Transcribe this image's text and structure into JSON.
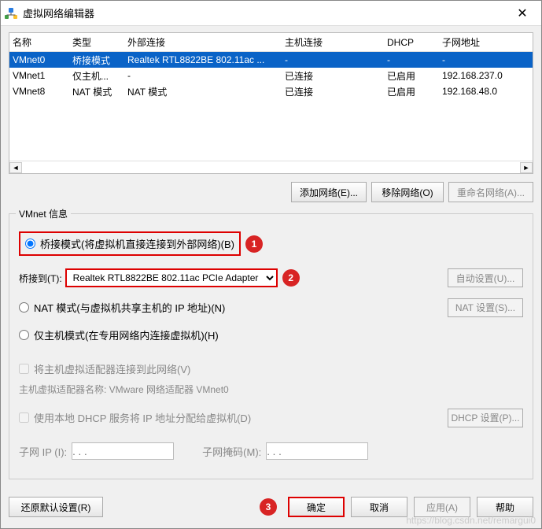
{
  "window": {
    "title": "虚拟网络编辑器"
  },
  "grid": {
    "headers": {
      "name": "名称",
      "type": "类型",
      "ext": "外部连接",
      "host": "主机连接",
      "dhcp": "DHCP",
      "subnet": "子网地址"
    },
    "rows": [
      {
        "name": "VMnet0",
        "type": "桥接模式",
        "ext": "Realtek RTL8822BE 802.11ac ...",
        "host": "-",
        "dhcp": "-",
        "subnet": "-"
      },
      {
        "name": "VMnet1",
        "type": "仅主机...",
        "ext": "-",
        "host": "已连接",
        "dhcp": "已启用",
        "subnet": "192.168.237.0"
      },
      {
        "name": "VMnet8",
        "type": "NAT 模式",
        "ext": "NAT 模式",
        "host": "已连接",
        "dhcp": "已启用",
        "subnet": "192.168.48.0"
      }
    ]
  },
  "actions": {
    "add": "添加网络(E)...",
    "remove": "移除网络(O)",
    "rename": "重命名网络(A)..."
  },
  "info": {
    "title": "VMnet 信息",
    "bridge_radio": "桥接模式(将虚拟机直接连接到外部网络)(B)",
    "bridge_to_label": "桥接到(T):",
    "bridge_adapter": "Realtek RTL8822BE 802.11ac PCIe Adapter",
    "auto_settings": "自动设置(U)...",
    "nat_radio": "NAT 模式(与虚拟机共享主机的 IP 地址)(N)",
    "nat_settings": "NAT 设置(S)...",
    "host_radio": "仅主机模式(在专用网络内连接虚拟机)(H)",
    "connect_host": "将主机虚拟适配器连接到此网络(V)",
    "adapter_name_label": "主机虚拟适配器名称: VMware 网络适配器 VMnet0",
    "use_dhcp": "使用本地 DHCP 服务将 IP 地址分配给虚拟机(D)",
    "dhcp_settings": "DHCP 设置(P)...",
    "subnet_ip_label": "子网 IP (I):",
    "subnet_mask_label": "子网掩码(M):",
    "subnet_ip_hint": ". . .",
    "subnet_mask_hint": ". . ."
  },
  "footer": {
    "restore": "还原默认设置(R)",
    "ok": "确定",
    "cancel": "取消",
    "apply": "应用(A)",
    "help": "帮助"
  },
  "markers": {
    "m1": "1",
    "m2": "2",
    "m3": "3"
  },
  "watermark": "https://blog.csdn.net/remargui0"
}
